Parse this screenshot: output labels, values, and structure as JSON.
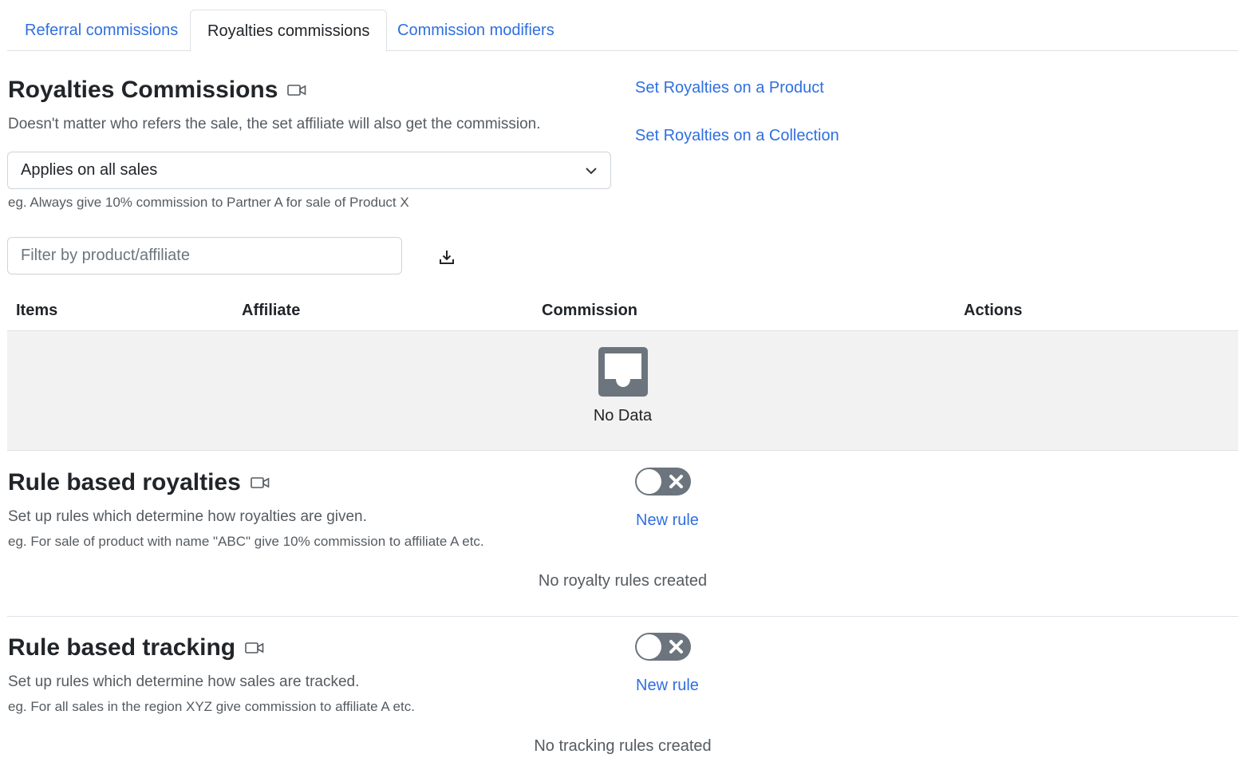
{
  "tabs": [
    {
      "label": "Referral commissions",
      "active": false
    },
    {
      "label": "Royalties commissions",
      "active": true
    },
    {
      "label": "Commission modifiers",
      "active": false
    }
  ],
  "royalties": {
    "title": "Royalties Commissions",
    "description": "Doesn't matter who refers the sale, the set affiliate will also get the commission.",
    "select_value": "Applies on all sales",
    "select_hint": "eg. Always give 10% commission to Partner A for sale of Product X",
    "links": {
      "product": "Set Royalties on a Product",
      "collection": "Set Royalties on a Collection"
    },
    "filter_placeholder": "Filter by product/affiliate",
    "table": {
      "columns": [
        "Items",
        "Affiliate",
        "Commission",
        "Actions"
      ],
      "empty_label": "No Data"
    }
  },
  "rule_royalties": {
    "title": "Rule based royalties",
    "description": "Set up rules which determine how royalties are given.",
    "example": "eg. For sale of product with name \"ABC\" give 10% commission to affiliate A etc.",
    "toggle_on": false,
    "new_rule": "New rule",
    "empty": "No royalty rules created"
  },
  "rule_tracking": {
    "title": "Rule based tracking",
    "description": "Set up rules which determine how sales are tracked.",
    "example": "eg. For all sales in the region XYZ give commission to affiliate A etc.",
    "toggle_on": false,
    "new_rule": "New rule",
    "empty": "No tracking rules created"
  },
  "icons": {
    "video": "video-camera-icon",
    "chevron": "chevron-down-icon",
    "download": "download-icon",
    "empty": "inbox-tray-icon",
    "toggle_off": "close-icon"
  },
  "colors": {
    "link": "#2f6fe0",
    "toggle_off": "#6c757d",
    "empty_bg": "#f2f2f2"
  }
}
